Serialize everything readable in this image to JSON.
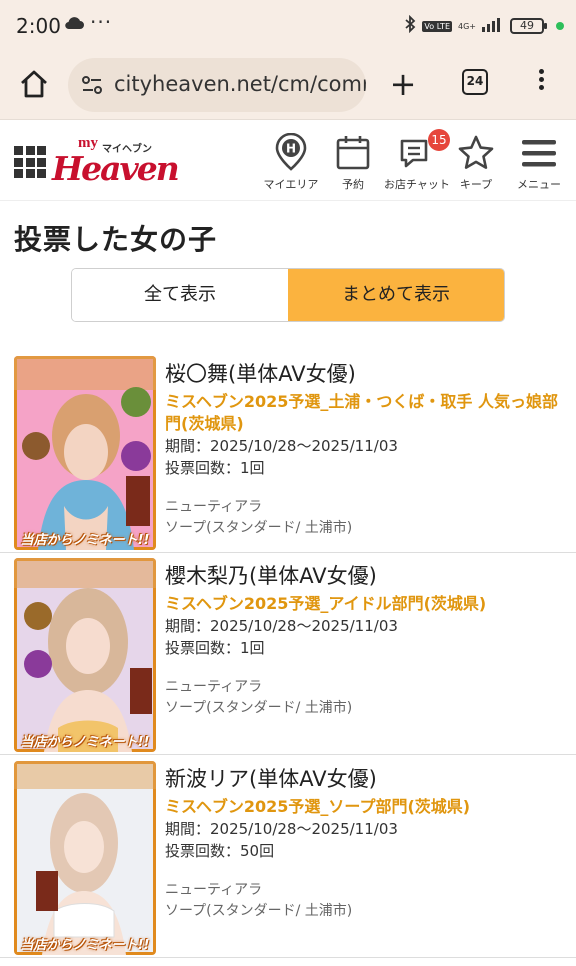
{
  "status_bar": {
    "time": "2:00",
    "dots": "···",
    "network_badge": "Vo LTE",
    "network_type": "4G+",
    "battery": "49"
  },
  "browser": {
    "url": "cityheaven.net/cm/comm",
    "tab_count": "24"
  },
  "header": {
    "logo_my": "my",
    "logo_kana": "マイヘブン",
    "logo_main": "Heaven",
    "nav": [
      {
        "label": "マイエリア",
        "icon": "map-pin-h-icon"
      },
      {
        "label": "予約",
        "icon": "calendar-icon"
      },
      {
        "label": "お店チャット",
        "icon": "chat-icon",
        "badge": "15"
      },
      {
        "label": "キープ",
        "icon": "star-icon"
      },
      {
        "label": "メニュー",
        "icon": "hamburger-icon"
      }
    ]
  },
  "page_title": "投票した女の子",
  "toggle": {
    "all": "全て表示",
    "grouped": "まとめて表示",
    "selected": "grouped"
  },
  "entries": [
    {
      "name": "桜〇舞(単体AV女優)",
      "election": "ミスヘブン2025予選_土浦・つくば・取手 人気っ娘部門(茨城県)",
      "period": "期間：2025/10/28〜2025/11/03",
      "votes": "投票回数：1回",
      "shop": "ニューティアラ",
      "category": "ソープ(スタンダード/ 土浦市)",
      "caption": "当店からノミネート!!"
    },
    {
      "name": "櫻木梨乃(単体AV女優)",
      "election": "ミスヘブン2025予選_アイドル部門(茨城県)",
      "period": "期間：2025/10/28〜2025/11/03",
      "votes": "投票回数：1回",
      "shop": "ニューティアラ",
      "category": "ソープ(スタンダード/ 土浦市)",
      "caption": "当店からノミネート!!"
    },
    {
      "name": "新波リア(単体AV女優)",
      "election": "ミスヘブン2025予選_ソープ部門(茨城県)",
      "period": "期間：2025/10/28〜2025/11/03",
      "votes": "投票回数：50回",
      "shop": "ニューティアラ",
      "category": "ソープ(スタンダード/ 土浦市)",
      "caption": "当店からノミネート!!"
    }
  ],
  "colors": {
    "accent": "#fbb33f",
    "election_text": "#e0960f",
    "brand": "#c8102e",
    "badge": "#e6463c"
  }
}
